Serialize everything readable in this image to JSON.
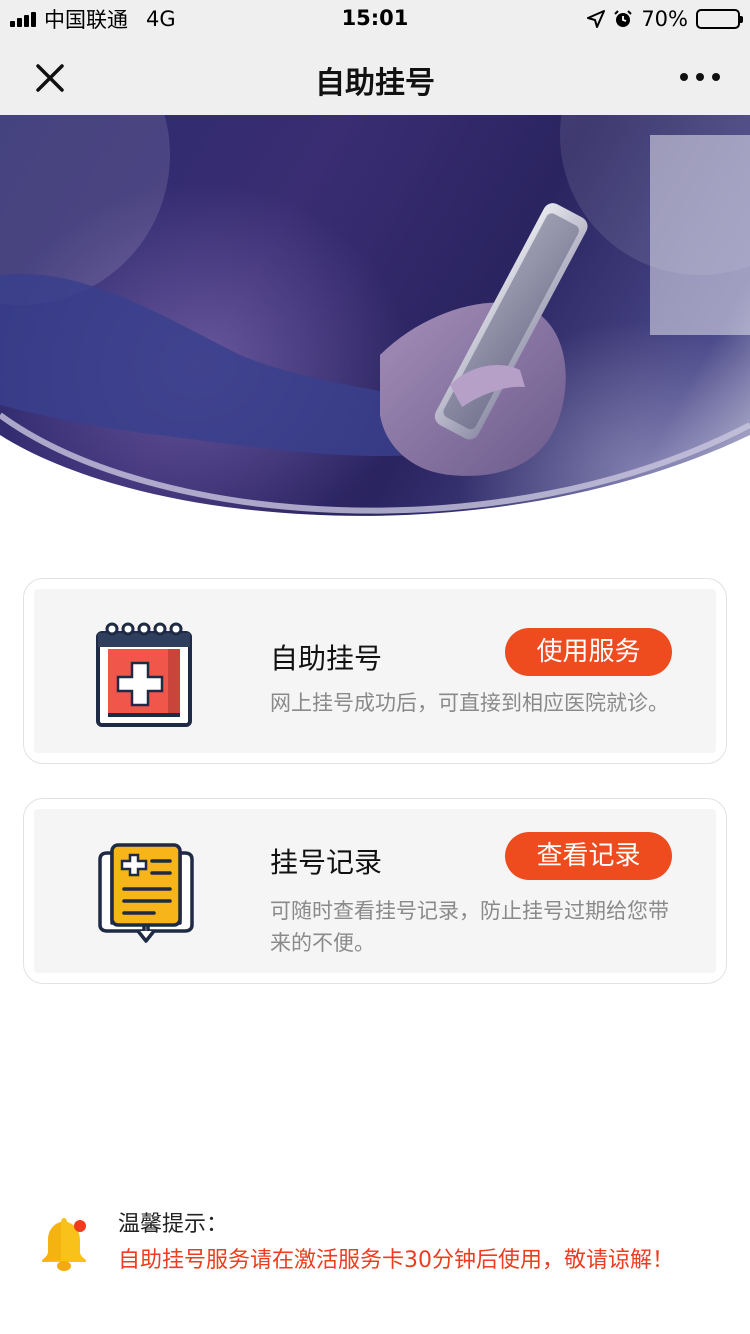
{
  "status_bar": {
    "carrier": "中国联通",
    "network": "4G",
    "time": "15:01",
    "battery": "70%",
    "battery_level": 0.7
  },
  "nav": {
    "title": "自助挂号",
    "close_icon": "close-icon",
    "more_icon": "more-icon"
  },
  "cards": [
    {
      "title": "自助挂号",
      "button": "使用服务",
      "description": "网上挂号成功后，可直接到相应医院就诊。",
      "icon": "calendar-medical-icon"
    },
    {
      "title": "挂号记录",
      "button": "查看记录",
      "description": "可随时查看挂号记录，防止挂号过期给您带来的不便。",
      "icon": "medical-record-book-icon"
    }
  ],
  "tip": {
    "title": "温馨提示：",
    "text": "自助挂号服务请在激活服务卡30分钟后使用，敬请谅解！",
    "icon": "bell-icon"
  },
  "colors": {
    "accent": "#ee4b1f",
    "tip_text": "#ee3c1e",
    "card_bg": "#f5f5f5",
    "bar_bg": "#efefef"
  }
}
